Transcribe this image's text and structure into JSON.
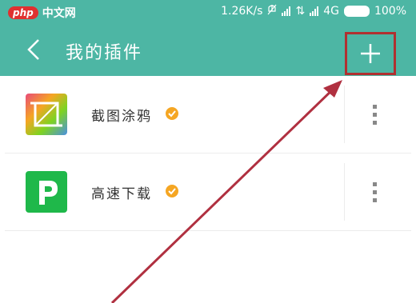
{
  "status_bar": {
    "watermark_logo": "php",
    "watermark_text": "中文网",
    "speed": "1.26K/s",
    "network": "4G",
    "battery": "100%"
  },
  "toolbar": {
    "title": "我的插件",
    "back_icon": "chevron-left-icon",
    "add_icon": "plus-icon"
  },
  "plugins": [
    {
      "name": "截图涂鸦",
      "icon": "crop-icon",
      "verified": true
    },
    {
      "name": "高速下载",
      "icon": "p-letter-icon",
      "verified": true
    }
  ],
  "colors": {
    "header": "#4db6a4",
    "highlight_box": "#b03030",
    "arrow": "#b03040",
    "verified_badge": "#f5a623"
  }
}
